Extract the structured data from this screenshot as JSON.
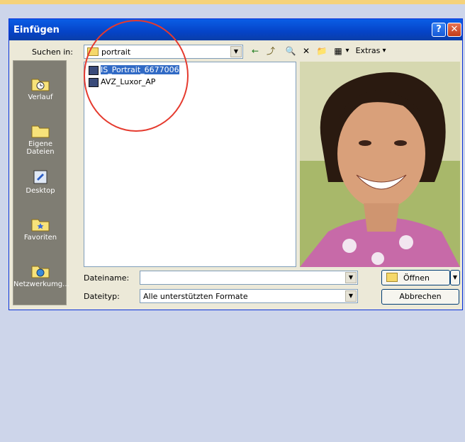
{
  "dialog": {
    "title": "Einfügen",
    "help_label": "?",
    "close_label": "✕"
  },
  "lookin": {
    "label": "Suchen in:",
    "value": "portrait",
    "arrow": "▼"
  },
  "toolbar": {
    "back_icon": "←",
    "up_icon": "⤴",
    "search_icon": "🔍",
    "delete_icon": "✕",
    "newfolder_icon": "📁",
    "views_icon": "▦",
    "views_arrow": "▾",
    "extras_label": "Extras",
    "extras_arrow": "▾"
  },
  "places": [
    {
      "label": "Verlauf"
    },
    {
      "label": "Eigene Dateien"
    },
    {
      "label": "Desktop"
    },
    {
      "label": "Favoriten"
    },
    {
      "label": "Netzwerkumg..."
    }
  ],
  "files": [
    {
      "name": "IS_Portrait_6677006",
      "selected": true
    },
    {
      "name": "AVZ_Luxor_AP",
      "selected": false
    }
  ],
  "filename": {
    "label": "Dateiname:",
    "value": "",
    "arrow": "▼"
  },
  "filetype": {
    "label": "Dateityp:",
    "value": "Alle unterstützten Formate",
    "arrow": "▼"
  },
  "buttons": {
    "open_label": "Öffnen",
    "open_arrow": "▼",
    "cancel_label": "Abbrechen"
  },
  "colors": {
    "titlebar": "#0543c7",
    "selection": "#316ac5",
    "highlight_circle": "#e53a2e"
  }
}
